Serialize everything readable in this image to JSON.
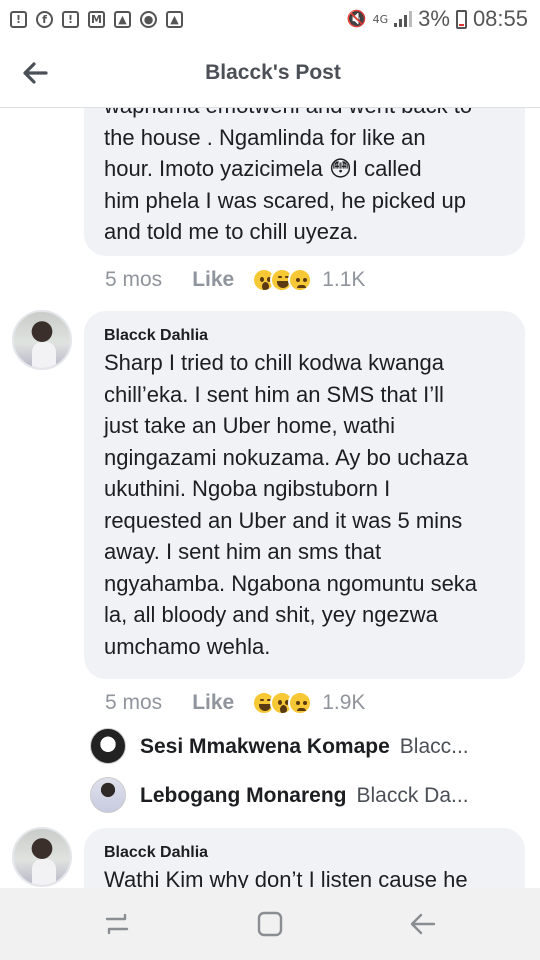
{
  "status_bar": {
    "left_icons": [
      "whatsapp-icon",
      "facebook-icon",
      "alert-icon",
      "gmail-icon",
      "photo-icon",
      "vpn-icon",
      "gallery-icon"
    ],
    "network": "4G",
    "battery": "3%",
    "time": "08:55"
  },
  "header": {
    "title": "Blacck's Post"
  },
  "comments": [
    {
      "author": "",
      "text": "waphuma emotweni and went back to\nthe house . Ngamlinda for like an\nhour. Imoto yazicimela 😳I called\nhim phela I was scared, he picked up\nand told me to chill uyeza.",
      "time": "5 mos",
      "like_label": "Like",
      "reactions": [
        "wow",
        "haha",
        "sad"
      ],
      "reaction_count": "1.1K"
    },
    {
      "author": "Blacck Dahlia",
      "text": " Sharp I tried to chill kodwa kwanga\nchill’eka. I sent him an SMS that I’ll\njust take an Uber home, wathi\nngingazami nokuzama. Ay bo uchaza\nukuthini. Ngoba ngibstuborn I\nrequested an Uber and it was 5 mins\naway. I sent him an sms that\nngyahamba. Ngabona ngomuntu seka\nla, all bloody and shit, yey ngezwa\numchamo wehla.",
      "time": "5 mos",
      "like_label": "Like",
      "reactions": [
        "haha",
        "wow",
        "sad"
      ],
      "reaction_count": "1.9K"
    },
    {
      "author": "Blacck Dahlia",
      "text": "Wathi Kim why don’t I listen cause he"
    }
  ],
  "replies": [
    {
      "name": "Sesi Mmakwena Komape",
      "snippet": "Blacc..."
    },
    {
      "name": "Lebogang Monareng",
      "snippet": "Blacck Da..."
    }
  ],
  "nav": {
    "buttons": [
      "recent-apps-icon",
      "home-icon",
      "back-icon"
    ]
  }
}
